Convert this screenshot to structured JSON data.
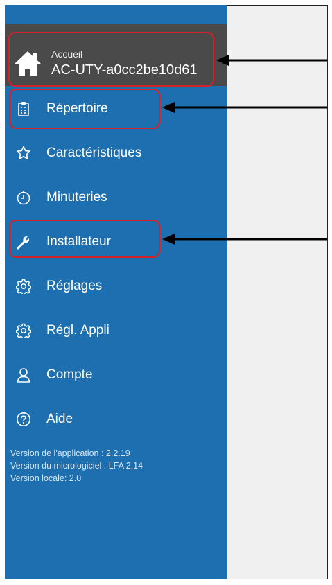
{
  "header": {
    "small_label": "Accueil",
    "device_name": "AC-UTY-a0cc2be10d61",
    "icon": "home-icon"
  },
  "menu": {
    "items": [
      {
        "label": "Répertoire",
        "icon": "clipboard-icon"
      },
      {
        "label": "Caractéristiques",
        "icon": "star-icon"
      },
      {
        "label": "Minuteries",
        "icon": "timer-icon"
      },
      {
        "label": "Installateur",
        "icon": "wrench-icon"
      },
      {
        "label": "Réglages",
        "icon": "gear-icon"
      },
      {
        "label": "Régl. Appli",
        "icon": "gear-icon"
      },
      {
        "label": "Compte",
        "icon": "user-icon"
      },
      {
        "label": "Aide",
        "icon": "help-icon"
      }
    ]
  },
  "versions": {
    "app": "Version de l'application : 2.2.19",
    "firmware": "Version du micrologiciel : LFA 2.14",
    "locale": "Version locale: 2.0"
  },
  "colors": {
    "sidebar": "#1e6fb0",
    "header": "#4a4a4a",
    "highlight": "#d2232a"
  }
}
